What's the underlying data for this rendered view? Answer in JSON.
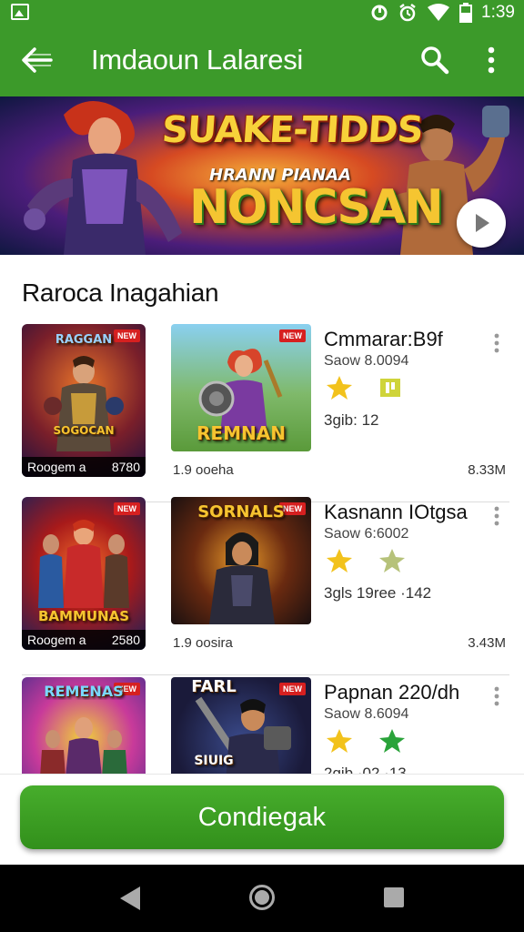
{
  "status_bar": {
    "time": "1:39",
    "icons": [
      "image-icon",
      "sync-icon",
      "alarm-icon",
      "wifi-icon",
      "battery-icon"
    ]
  },
  "app_bar": {
    "title": "Imdaoun Lalaresi",
    "icons": [
      "back-arrow-icon",
      "search-icon",
      "more-vert-icon"
    ]
  },
  "banner": {
    "title": "SUAKE-TIDDS",
    "subtitle": "HRANN PIANAA",
    "big_text": "NONCSAN",
    "play_icon": "play-icon"
  },
  "section": {
    "title": "Raroca Inagahian"
  },
  "items": [
    {
      "thumb_a": {
        "label": "RAGGAN",
        "caption_left": "Roogem a",
        "caption_right": "8780",
        "badge": "NEW"
      },
      "thumb_b": {
        "label": "REMNAN",
        "badge": "NEW"
      },
      "sub_left": "1.9 ooeha",
      "size": "8.33M",
      "title": "Cmmarar:B9f",
      "meta": "Saow 8.0094",
      "stats": "3gib: 12",
      "star_colors": [
        "#f2c21c",
        "#cfd43a"
      ]
    },
    {
      "thumb_a": {
        "label": "BAMMUNAS",
        "caption_left": "Roogem a",
        "caption_right": "2580",
        "badge": "NEW"
      },
      "thumb_b": {
        "label": "SORNALS",
        "badge": "NEW"
      },
      "sub_left": "1.9 oosira",
      "size": "3.43M",
      "title": "Kasnann IOtgsa",
      "meta": "Saow 6:6002",
      "stats": "3gls  19ree  ·142",
      "star_colors": [
        "#f2c21c",
        "#b6c27a"
      ]
    },
    {
      "thumb_a": {
        "label": "REMENAS",
        "caption_left": "",
        "caption_right": "",
        "badge": "NEW"
      },
      "thumb_b": {
        "label": "SIUIG",
        "badge": "NEW"
      },
      "sub_left": "",
      "size": "",
      "title": "Papnan 220/dh",
      "meta": "Saow 8.6094",
      "stats": "2gib  ·02            ·13",
      "star_colors": [
        "#f2c21c",
        "#2aa33a"
      ]
    }
  ],
  "cta": {
    "label": "Condiegak"
  },
  "nav_bar": {
    "icons": [
      "back-triangle-icon",
      "home-circle-icon",
      "recents-square-icon"
    ]
  },
  "colors": {
    "primary": "#3c9a2a",
    "button": "#3a9a22",
    "nav": "#000000"
  }
}
